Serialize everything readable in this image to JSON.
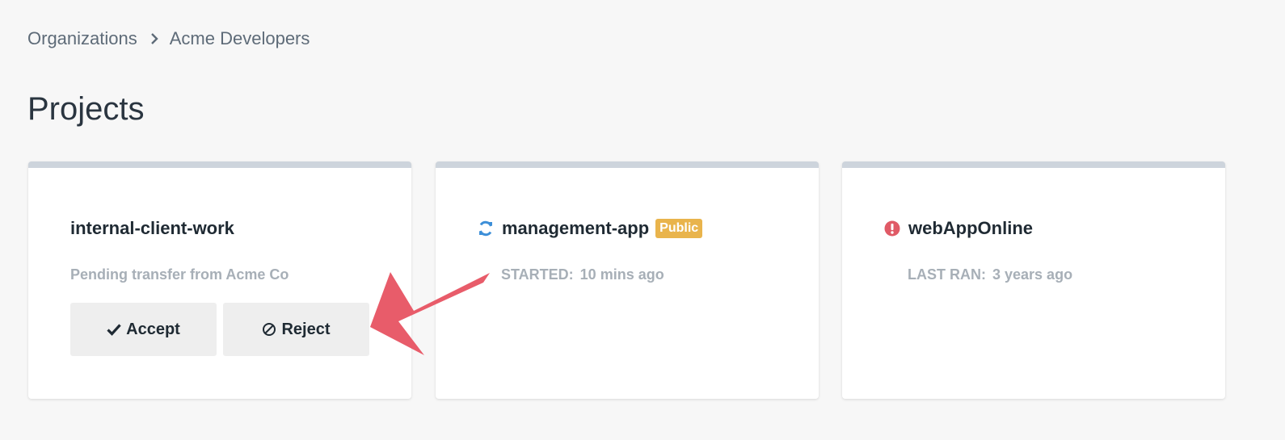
{
  "breadcrumb": {
    "items": [
      "Organizations",
      "Acme Developers"
    ]
  },
  "page": {
    "title": "Projects"
  },
  "cards": [
    {
      "name": "internal-client-work",
      "status_text": "Pending transfer from Acme Co",
      "accept_label": "Accept",
      "reject_label": "Reject"
    },
    {
      "name": "management-app",
      "status_icon": "sync-icon",
      "badge": "Public",
      "meta_label": "STARTED:",
      "meta_value": "10 mins ago"
    },
    {
      "name": "webAppOnline",
      "status_icon": "error-icon",
      "meta_label": "LAST RAN:",
      "meta_value": "3 years ago"
    }
  ],
  "colors": {
    "background": "#f7f7f7",
    "card_top_border": "#cdd4dc",
    "badge": "#e9b44c",
    "sync_icon": "#3d8fd8",
    "error_icon": "#e05a66",
    "annotation_arrow": "#e85c6a",
    "button_bg": "#eeeeee"
  }
}
